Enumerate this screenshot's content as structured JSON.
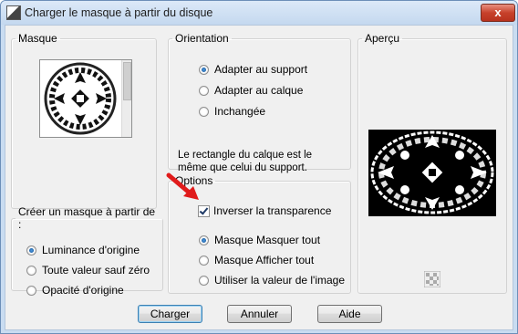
{
  "window": {
    "title": "Charger le masque à partir du disque",
    "close_label": "x"
  },
  "masque": {
    "label": "Masque"
  },
  "source": {
    "label": "Créer un masque à partir de :",
    "options": [
      {
        "label": "Luminance d'origine",
        "selected": true
      },
      {
        "label": "Toute valeur sauf zéro",
        "selected": false
      },
      {
        "label": "Opacité d'origine",
        "selected": false
      }
    ]
  },
  "orientation": {
    "label": "Orientation",
    "options": [
      {
        "label": "Adapter au support",
        "selected": true
      },
      {
        "label": "Adapter au calque",
        "selected": false
      },
      {
        "label": "Inchangée",
        "selected": false
      }
    ],
    "note": "Le rectangle du calque est le même que celui du support."
  },
  "options": {
    "label": "Options",
    "invert": {
      "label": "Inverser la transparence",
      "checked": true
    },
    "modes": [
      {
        "label": "Masque Masquer tout",
        "selected": true
      },
      {
        "label": "Masque Afficher tout",
        "selected": false
      },
      {
        "label": "Utiliser la valeur de l'image",
        "selected": false
      }
    ]
  },
  "preview": {
    "label": "Aperçu"
  },
  "buttons": {
    "load": "Charger",
    "cancel": "Annuler",
    "help": "Aide"
  },
  "colors": {
    "accent": "#3c7fb1",
    "arrow": "#e01b1b",
    "close": "#c7412b",
    "title_bar": "#c9dcf1"
  }
}
